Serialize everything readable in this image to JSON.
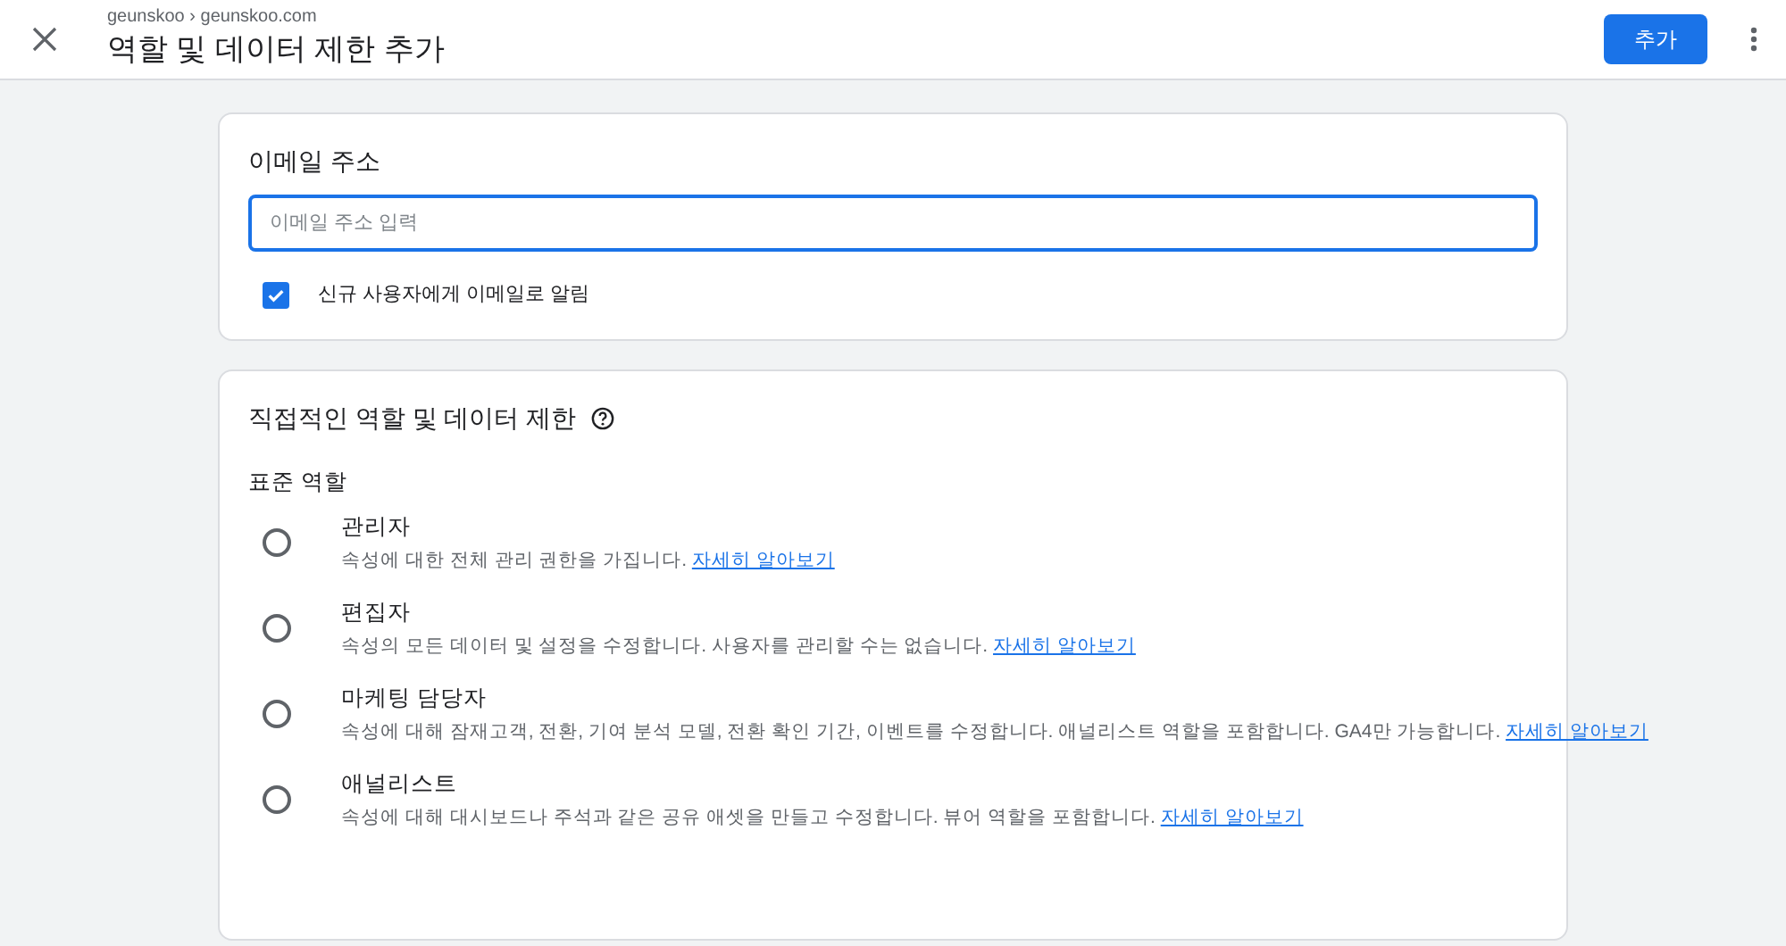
{
  "header": {
    "breadcrumb": "geunskoo › geunskoo.com",
    "title": "역할 및 데이터 제한 추가",
    "add_button": "추가"
  },
  "email_card": {
    "title": "이메일 주소",
    "placeholder": "이메일 주소 입력",
    "notify": {
      "label": "신규 사용자에게 이메일로 알림",
      "checked": true
    }
  },
  "roles_card": {
    "title": "직접적인 역할 및 데이터 제한",
    "section": "표준 역할",
    "roles": [
      {
        "name": "관리자",
        "description": "속성에 대한 전체 관리 권한을 가집니다.",
        "link": "자세히 알아보기",
        "selected": false
      },
      {
        "name": "편집자",
        "description": "속성의 모든 데이터 및 설정을 수정합니다. 사용자를 관리할 수는 없습니다.",
        "link": "자세히 알아보기",
        "selected": false
      },
      {
        "name": "마케팅 담당자",
        "description": "속성에 대해 잠재고객, 전환, 기여 분석 모델, 전환 확인 기간, 이벤트를 수정합니다. 애널리스트 역할을 포함합니다. GA4만 가능합니다.",
        "link": "자세히 알아보기",
        "selected": false
      },
      {
        "name": "애널리스트",
        "description": "속성에 대해 대시보드나 주석과 같은 공유 애셋을 만들고 수정합니다. 뷰어 역할을 포함합니다.",
        "link": "자세히 알아보기",
        "selected": false
      }
    ]
  }
}
